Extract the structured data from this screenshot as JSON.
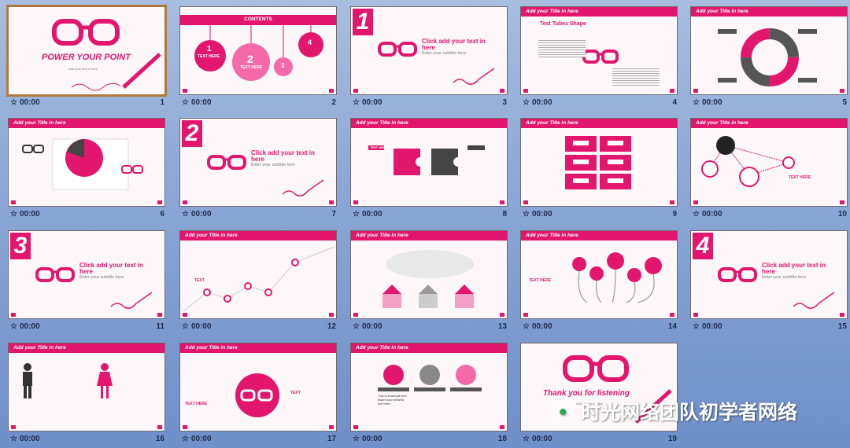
{
  "slides": [
    {
      "num": "1",
      "time": "00:00",
      "title": "POWER YOUR POINT",
      "subtitle": "Add your text in here"
    },
    {
      "num": "2",
      "time": "00:00",
      "header": "CONTENTS",
      "items": [
        "1",
        "TEXT HERE",
        "2",
        "TEXT HERE",
        "3",
        "4"
      ]
    },
    {
      "num": "3",
      "time": "00:00",
      "section": "1",
      "title": "Click add your text in here",
      "subtitle": "Enter your subtitle here"
    },
    {
      "num": "4",
      "time": "00:00",
      "header": "Add your Title in here",
      "title": "Test Tubes Shape"
    },
    {
      "num": "5",
      "time": "00:00",
      "header": "Add your Title in here"
    },
    {
      "num": "6",
      "time": "00:00",
      "header": "Add your Title in here"
    },
    {
      "num": "7",
      "time": "00:00",
      "section": "2",
      "title": "Click add your text in here",
      "subtitle": "Enter your subtitle here"
    },
    {
      "num": "8",
      "time": "00:00",
      "header": "Add your Title in here",
      "label": "TEXT HERE"
    },
    {
      "num": "9",
      "time": "00:00",
      "header": "Add your Title in here"
    },
    {
      "num": "10",
      "time": "00:00",
      "header": "Add your Title in here",
      "label": "TEXT HERE"
    },
    {
      "num": "11",
      "time": "00:00",
      "section": "3",
      "title": "Click add your text in here",
      "subtitle": "Enter your subtitle here"
    },
    {
      "num": "12",
      "time": "00:00",
      "header": "Add your Title in here",
      "label": "TEXT"
    },
    {
      "num": "13",
      "time": "00:00",
      "header": "Add your Title in here"
    },
    {
      "num": "14",
      "time": "00:00",
      "header": "Add your Title in here",
      "label": "TEXT HERE"
    },
    {
      "num": "15",
      "time": "00:00",
      "section": "4",
      "title": "Click add your text in here",
      "subtitle": "Enter your subtitle here"
    },
    {
      "num": "16",
      "time": "00:00",
      "header": "Add your Title in here"
    },
    {
      "num": "17",
      "time": "00:00",
      "header": "Add your Title in here",
      "label": "TEXT HERE",
      "label2": "TEXT"
    },
    {
      "num": "18",
      "time": "00:00",
      "header": "Add your Title in here",
      "sample": "This is a sample text. Insert your desired text here."
    },
    {
      "num": "19",
      "time": "00:00",
      "title": "Thank you for listening",
      "subtitle": "Add your text in here"
    }
  ],
  "watermark": "时光网络团队初学者网络",
  "icons": {
    "timing": "star-icon",
    "glasses": "glasses-icon",
    "pen": "pen-icon",
    "wechat": "wechat-icon"
  },
  "colors": {
    "accent": "#e3166e",
    "background": "#8aa6d6",
    "selected_border": "#b07b3a"
  }
}
